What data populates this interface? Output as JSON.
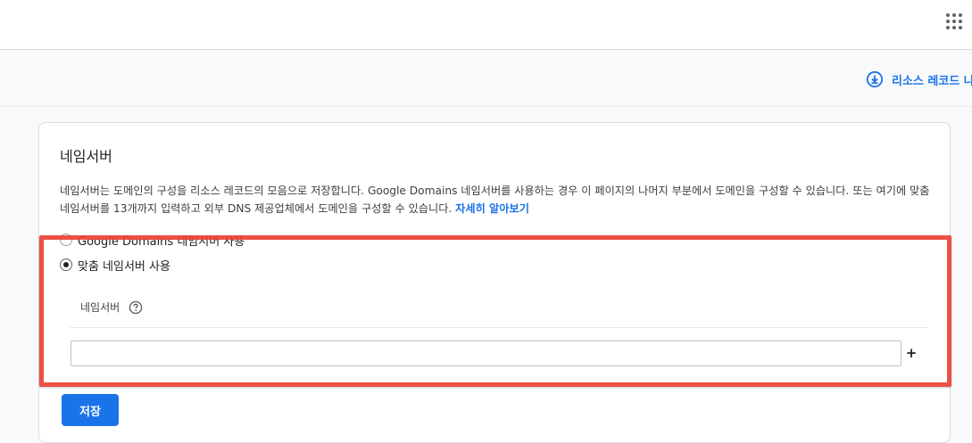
{
  "header": {
    "apps_icon": "apps-grid-icon"
  },
  "subbar": {
    "download_label": "리소스 레코드 나",
    "download_icon": "download-icon"
  },
  "card": {
    "title": "네임서버",
    "description": "네임서버는 도메인의 구성을 리소스 레코드의 모음으로 저장합니다. Google Domains 네임서버를 사용하는 경우 이 페이지의 나머지 부분에서 도메인을 구성할 수 있습니다. 또는 여기에 맞춤 네임서버를 13개까지 입력하고 외부 DNS 제공업체에서 도메인을 구성할 수 있습니다. ",
    "learn_more": "자세히 알아보기",
    "options": [
      {
        "label": "Google Domains 네임서버 사용",
        "selected": false
      },
      {
        "label": "맞춤 네임서버 사용",
        "selected": true
      }
    ],
    "nameserver_header": "네임서버",
    "help_icon": "help-circle-icon",
    "nameserver_value": "",
    "add_label": "+",
    "save_label": "저장"
  },
  "colors": {
    "accent": "#1a73e8",
    "highlight": "#ea4335"
  }
}
